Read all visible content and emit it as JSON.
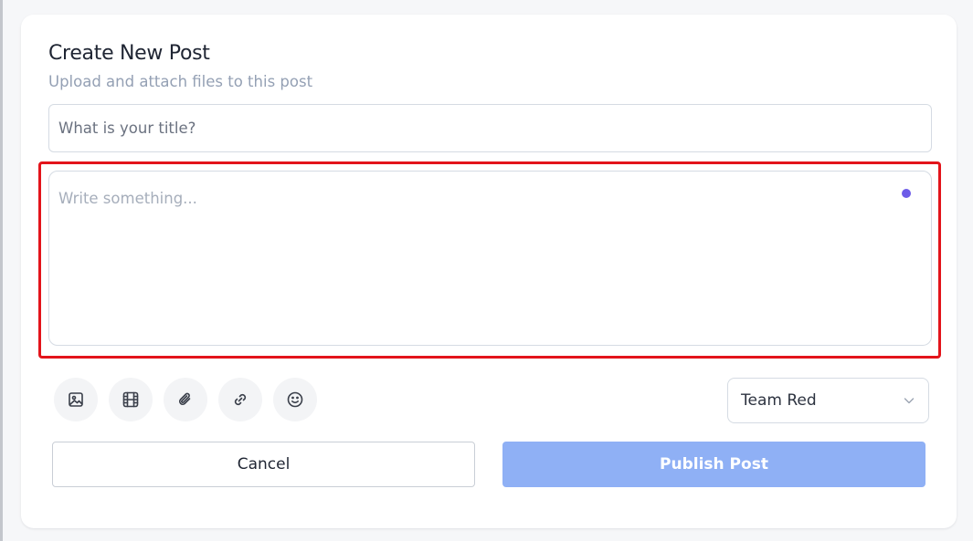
{
  "form": {
    "title": "Create New Post",
    "subtitle": "Upload and attach files to this post",
    "title_placeholder": "What is your title?",
    "body_placeholder": "Write something..."
  },
  "toolbar": {
    "tools": [
      "image-icon",
      "video-icon",
      "paperclip-icon",
      "link-icon",
      "emoji-icon"
    ],
    "team_select_value": "Team Red"
  },
  "actions": {
    "cancel_label": "Cancel",
    "publish_label": "Publish Post"
  },
  "colors": {
    "accent_dot": "#6d5ce8",
    "publish_bg": "#8fb0f5",
    "highlight_border": "#e3141b"
  }
}
